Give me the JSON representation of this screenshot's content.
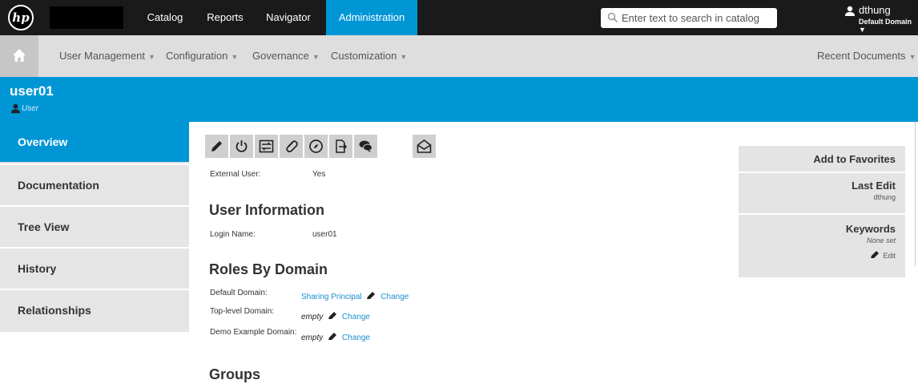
{
  "topbar": {
    "logo": "hp",
    "nav": [
      "Catalog",
      "Reports",
      "Navigator",
      "Administration"
    ],
    "search_placeholder": "Enter text to search in catalog",
    "user": "dthung",
    "user_domain": "Default Domain ▼"
  },
  "menubar": {
    "items": [
      "User Management",
      "Configuration",
      "Governance",
      "Customization"
    ],
    "recent": "Recent Documents"
  },
  "header": {
    "title": "user01",
    "subtitle": "User"
  },
  "sidenav": [
    "Overview",
    "Documentation",
    "Tree View",
    "History",
    "Relationships"
  ],
  "toolbar_icons": [
    "pencil-icon",
    "power-icon",
    "compare-icon",
    "paperclip-icon",
    "compass-icon",
    "export-icon",
    "comment-icon",
    "envelope-icon"
  ],
  "external_user": {
    "label": "External User:",
    "value": "Yes"
  },
  "user_info": {
    "title": "User Information",
    "login_label": "Login Name:",
    "login_value": "user01"
  },
  "roles": {
    "title": "Roles By Domain",
    "rows": [
      {
        "label": "Default Domain:",
        "value": "Sharing Principal",
        "change": "Change"
      },
      {
        "label": "Top-level Domain:",
        "value": "empty",
        "change": "Change"
      },
      {
        "label": "Demo Example Domain:",
        "value": "empty",
        "change": "Change"
      }
    ]
  },
  "groups": {
    "title": "Groups"
  },
  "right_panel": {
    "favorites": "Add to Favorites",
    "last_edit_title": "Last Edit",
    "last_edit_user": "dthung",
    "keywords_title": "Keywords",
    "keywords_value": "None set",
    "edit": "Edit"
  },
  "colors": {
    "accent": "#0096d6",
    "topbar": "#1a1a1a",
    "link": "#1a8fd0"
  }
}
